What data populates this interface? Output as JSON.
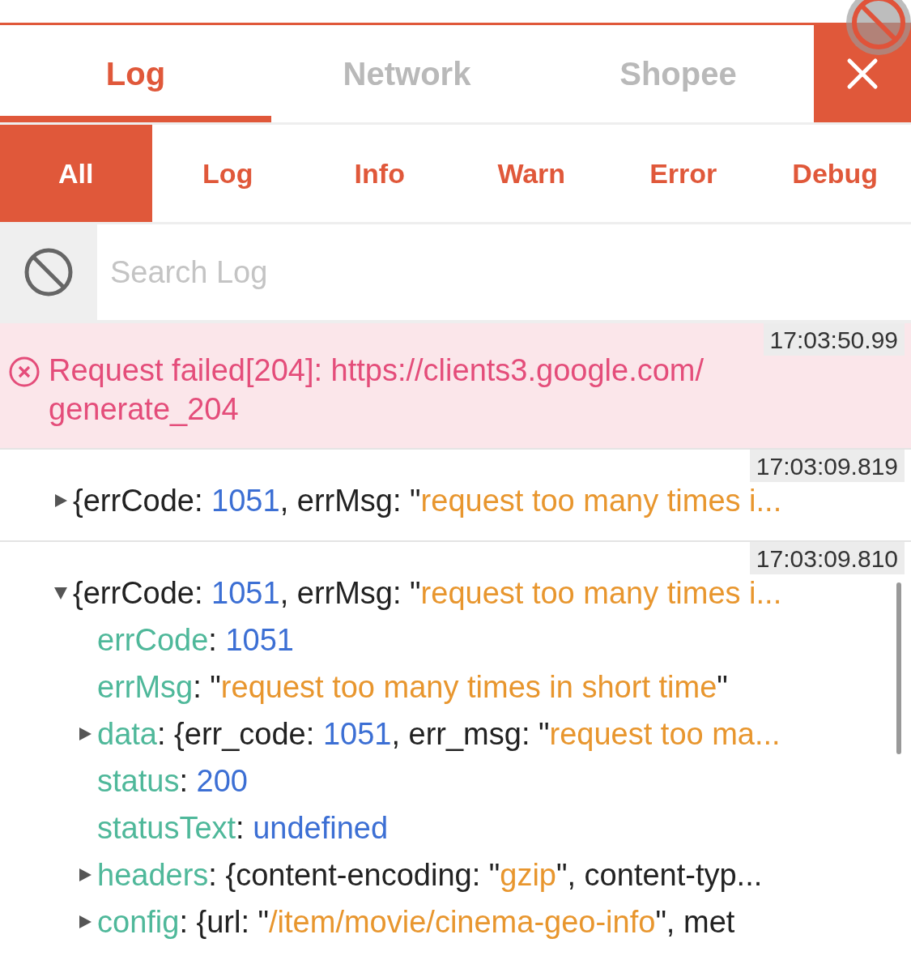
{
  "top_tabs": [
    {
      "label": "Log",
      "selected": true
    },
    {
      "label": "Network",
      "selected": false
    },
    {
      "label": "Shopee",
      "selected": false
    }
  ],
  "filter_tabs": [
    {
      "label": "All",
      "selected": true
    },
    {
      "label": "Log",
      "selected": false
    },
    {
      "label": "Info",
      "selected": false
    },
    {
      "label": "Warn",
      "selected": false
    },
    {
      "label": "Error",
      "selected": false
    },
    {
      "label": "Debug",
      "selected": false
    }
  ],
  "search": {
    "placeholder": "Search Log"
  },
  "entries": [
    {
      "kind": "error",
      "time": "17:03:50.99",
      "lines": [
        "Request failed[204]: https://clients3.google.com/",
        "generate_204"
      ]
    },
    {
      "kind": "object",
      "time": "17:03:09.819",
      "expanded": false,
      "summary": [
        {
          "kind": "plain",
          "t": "{errCode: "
        },
        {
          "kind": "number",
          "t": "1051"
        },
        {
          "kind": "plain",
          "t": ", errMsg: \""
        },
        {
          "kind": "string",
          "t": "request too many times i..."
        }
      ]
    },
    {
      "kind": "object",
      "time": "17:03:09.810",
      "expanded": true,
      "summary": [
        {
          "kind": "plain",
          "t": "{errCode: "
        },
        {
          "kind": "number",
          "t": "1051"
        },
        {
          "kind": "plain",
          "t": ", errMsg: \""
        },
        {
          "kind": "string",
          "t": "request too many times i..."
        }
      ],
      "children": [
        {
          "expandable": false,
          "segments": [
            {
              "kind": "key",
              "t": "errCode"
            },
            {
              "kind": "plain",
              "t": ": "
            },
            {
              "kind": "number",
              "t": "1051"
            }
          ]
        },
        {
          "expandable": false,
          "segments": [
            {
              "kind": "key",
              "t": "errMsg"
            },
            {
              "kind": "plain",
              "t": ": \""
            },
            {
              "kind": "string",
              "t": "request too many times in short time"
            },
            {
              "kind": "plain",
              "t": "\""
            }
          ]
        },
        {
          "expandable": true,
          "segments": [
            {
              "kind": "key",
              "t": "data"
            },
            {
              "kind": "plain",
              "t": ": {err_code: "
            },
            {
              "kind": "number",
              "t": "1051"
            },
            {
              "kind": "plain",
              "t": ", err_msg: \""
            },
            {
              "kind": "string",
              "t": "request too ma..."
            }
          ]
        },
        {
          "expandable": false,
          "segments": [
            {
              "kind": "key",
              "t": "status"
            },
            {
              "kind": "plain",
              "t": ": "
            },
            {
              "kind": "number",
              "t": "200"
            }
          ]
        },
        {
          "expandable": false,
          "segments": [
            {
              "kind": "key",
              "t": "statusText"
            },
            {
              "kind": "plain",
              "t": ": "
            },
            {
              "kind": "number",
              "t": "undefined"
            }
          ]
        },
        {
          "expandable": true,
          "segments": [
            {
              "kind": "key",
              "t": "headers"
            },
            {
              "kind": "plain",
              "t": ": {content-encoding: \""
            },
            {
              "kind": "string",
              "t": "gzip"
            },
            {
              "kind": "plain",
              "t": "\", content-typ..."
            }
          ]
        },
        {
          "expandable": true,
          "segments": [
            {
              "kind": "key",
              "t": "config"
            },
            {
              "kind": "plain",
              "t": ": {url: \""
            },
            {
              "kind": "string",
              "t": "/item/movie/cinema-geo-info"
            },
            {
              "kind": "plain",
              "t": "\", met"
            }
          ]
        }
      ]
    }
  ]
}
